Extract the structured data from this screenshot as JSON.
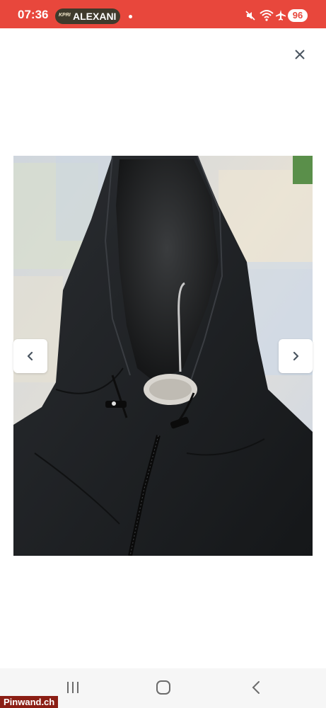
{
  "status_bar": {
    "time": "07:36",
    "notification_app": "KPRI",
    "notification_text": "ALEXANI",
    "battery": "96",
    "icons": [
      "mute-icon",
      "wifi-icon",
      "airplane-icon"
    ]
  },
  "viewer": {
    "close_icon": "close-icon",
    "prev_icon": "chevron-left-icon",
    "next_icon": "chevron-right-icon",
    "image_subject": "black softshell jacket with hood and fleece lining"
  },
  "nav_bar": {
    "icons": [
      "recents-icon",
      "home-icon",
      "back-icon"
    ]
  },
  "watermark": "Pinwand.ch",
  "colors": {
    "status_bar": "#e8473c",
    "background": "#ffffff",
    "icon": "#4a5560"
  }
}
